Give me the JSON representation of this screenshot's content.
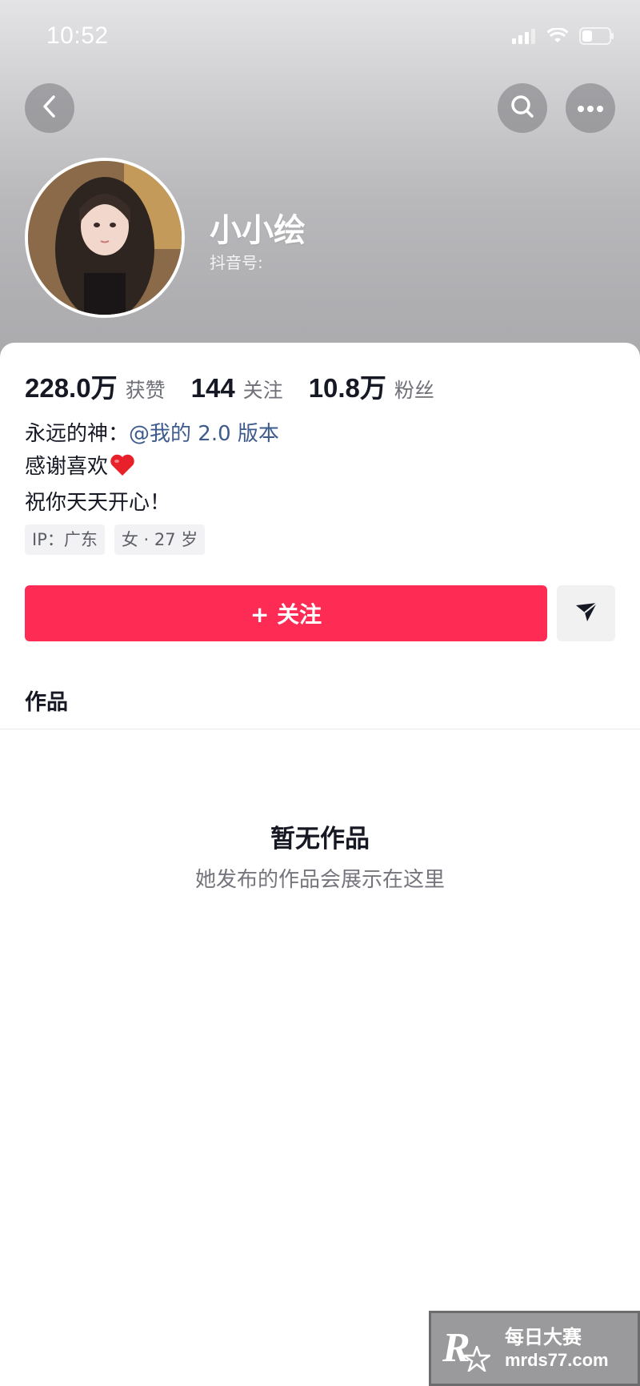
{
  "status_bar": {
    "time": "10:52",
    "icons": [
      "signal-icon",
      "wifi-icon",
      "battery-icon"
    ]
  },
  "header": {
    "back_icon": "chevron-left-icon",
    "search_icon": "search-icon",
    "more_icon": "more-dots-icon"
  },
  "profile": {
    "nickname": "小小绘",
    "douyin_id_label": "抖音号:",
    "stats": [
      {
        "value": "228.0万",
        "label": "获赞"
      },
      {
        "value": "144",
        "label": "关注"
      },
      {
        "value": "10.8万",
        "label": "粉丝"
      }
    ],
    "bio": {
      "line1_prefix": "永远的神：",
      "line1_mention": "@我的 2.0 版本",
      "line2": "感谢喜欢",
      "line3": "祝你天天开心！"
    },
    "tags": [
      "IP：广东",
      "女 · 27 岁"
    ]
  },
  "actions": {
    "follow_label": "+ 关注",
    "share_icon": "send-icon"
  },
  "tabs": {
    "works_label": "作品"
  },
  "empty_state": {
    "title": "暂无作品",
    "subtitle": "她发布的作品会展示在这里"
  },
  "watermark": {
    "logo_letter": "R",
    "cn_text": "每日大赛",
    "url": "mrds77.com"
  },
  "colors": {
    "accent": "#fe2c55",
    "mention": "#3d5b8d"
  }
}
